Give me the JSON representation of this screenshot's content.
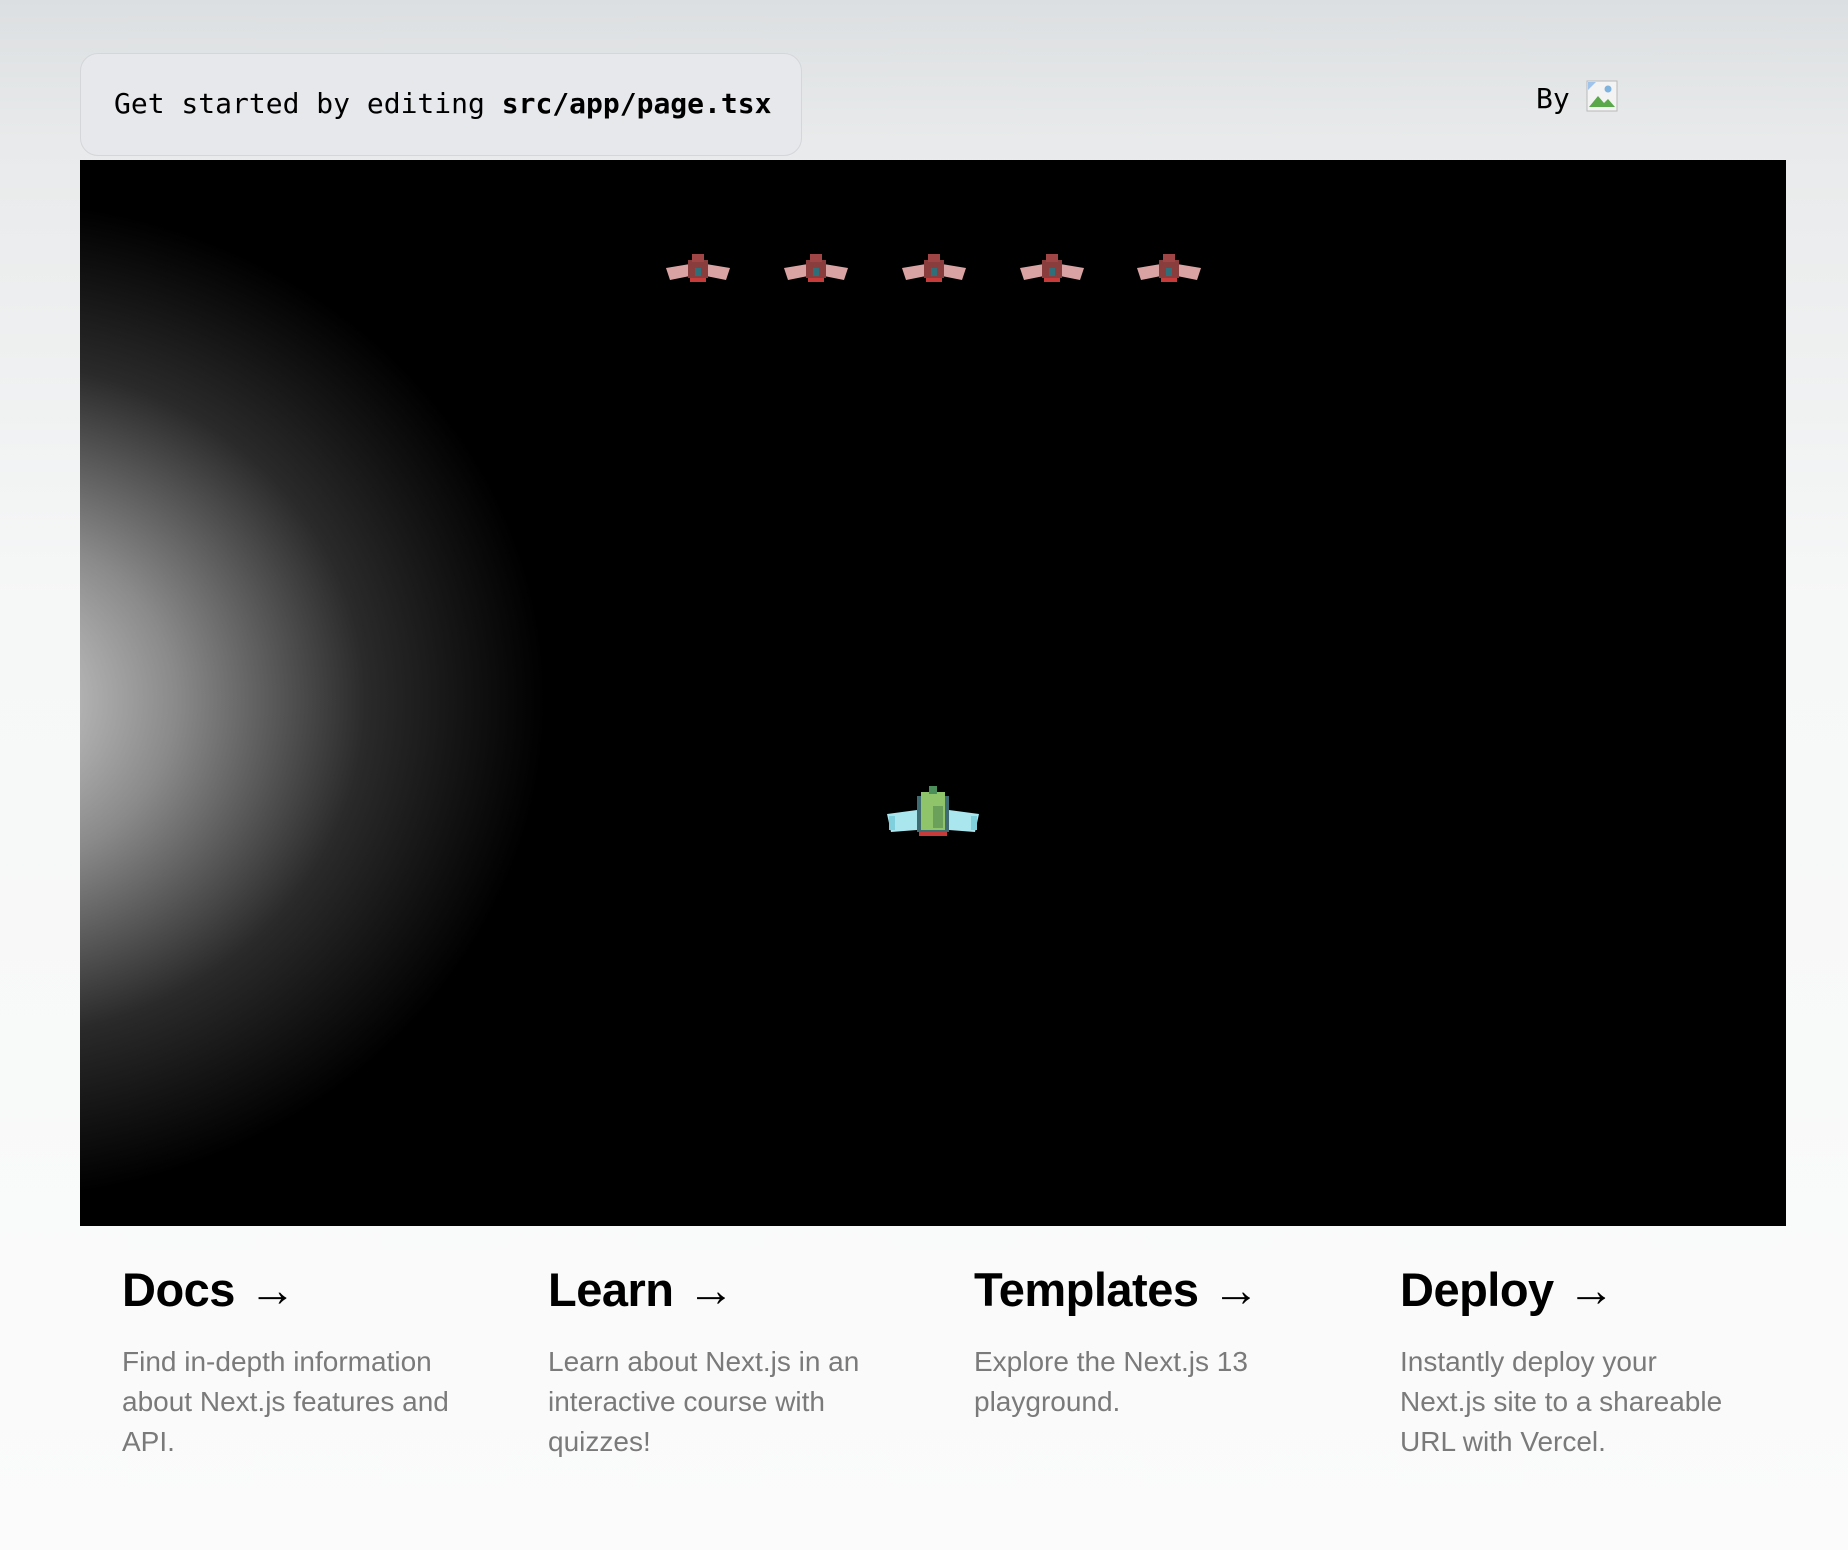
{
  "header": {
    "code_prefix": "Get started by editing ",
    "code_path": "src/app/page.tsx",
    "by_label": "By"
  },
  "game": {
    "background": "#000000",
    "enemy_count": 5,
    "player_icon": "player-spaceship-icon",
    "enemy_icon": "enemy-spaceship-icon"
  },
  "cards": [
    {
      "title": "Docs",
      "arrow": "->",
      "description": "Find in-depth information about Next.js features and API."
    },
    {
      "title": "Learn",
      "arrow": "->",
      "description": "Learn about Next.js in an interactive course with quizzes!"
    },
    {
      "title": "Templates",
      "arrow": "->",
      "description": "Explore the Next.js 13 playground."
    },
    {
      "title": "Deploy",
      "arrow": "->",
      "description": "Instantly deploy your Next.js site to a shareable URL with Vercel."
    }
  ]
}
